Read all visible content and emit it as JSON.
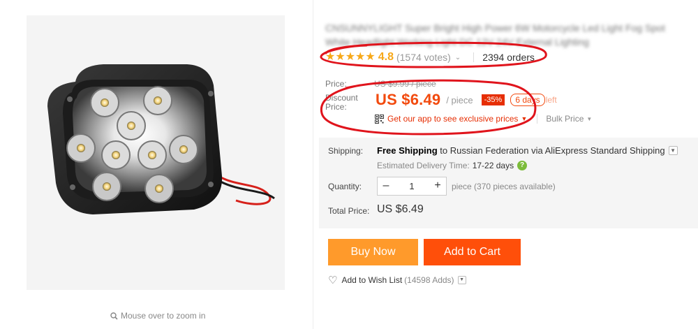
{
  "product": {
    "title": "CNSUNNYLIGHT Super Bright High Power 6W Motorcycle Led Light Fog Spot White Headlight Working Light DC 12V 24V External Lighting",
    "zoom_hint": "Mouse over to zoom in",
    "icons": {
      "zoom": "magnifier-icon",
      "rating": "star-icon",
      "qr": "qr-code-icon",
      "wishlist": "heart-icon",
      "help": "question-icon"
    }
  },
  "rating": {
    "value": "4.8",
    "stars": 5,
    "votes": "(1574 votes)",
    "orders": "2394 orders"
  },
  "price": {
    "label": "Price:",
    "original": "US $9.99 / piece",
    "discount_label": "Discount Price:",
    "discount_value": "US $6.49",
    "per_unit": "/ piece",
    "discount_badge": "-35%",
    "days_left_badge": "6 days",
    "days_left_suffix": "left",
    "app_promo": "Get our app to see exclusive prices",
    "bulk_price": "Bulk Price"
  },
  "shipping": {
    "label": "Shipping:",
    "free": "Free Shipping",
    "to": "to Russian Federation via AliExpress Standard Shipping",
    "eta_label": "Estimated Delivery Time:",
    "eta_value": "17-22 days"
  },
  "quantity": {
    "label": "Quantity:",
    "value": "1",
    "minus": "–",
    "plus": "+",
    "available": "piece (370 pieces available)"
  },
  "total": {
    "label": "Total Price:",
    "value": "US $6.49"
  },
  "actions": {
    "buy_now": "Buy Now",
    "add_to_cart": "Add to Cart",
    "wishlist": "Add to Wish List",
    "wishlist_adds": "(14598 Adds)"
  },
  "colors": {
    "price_orange": "#f24a0e",
    "buy_button": "#ff9a2b",
    "cart_button": "#ff4f0a",
    "star": "#f7a818",
    "annotation_red": "#e0141c"
  }
}
